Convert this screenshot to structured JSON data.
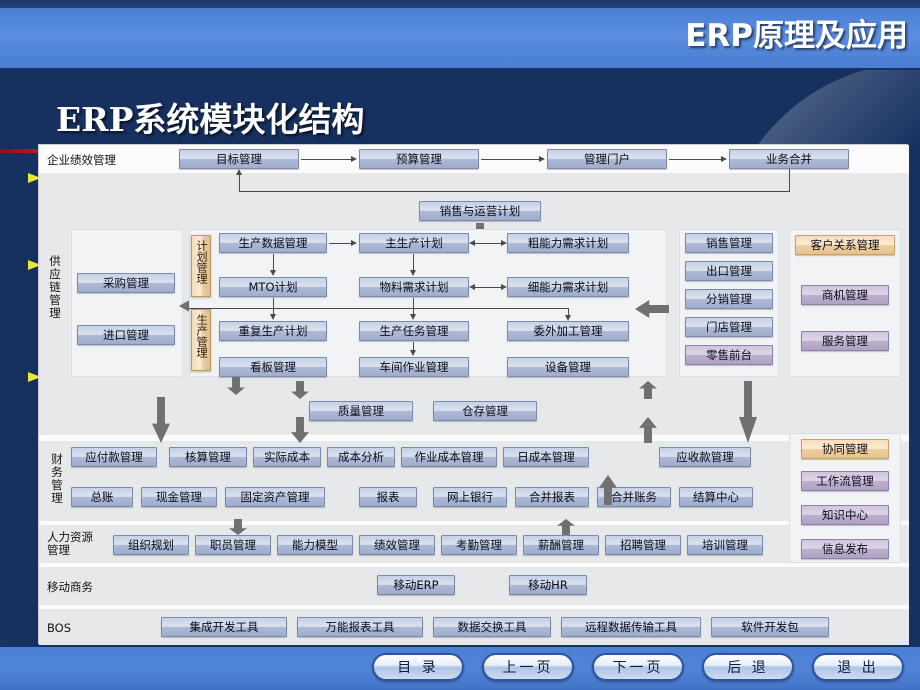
{
  "header": {
    "course_title": "ERP原理及应用",
    "slide_title": "ERP系统模块化结构"
  },
  "diagram": {
    "row_labels": {
      "epm": "企业绩效管理",
      "scm": "供应链管理",
      "fin": "财务管理",
      "hr": "人力资源管理",
      "mobile": "移动商务",
      "bos": "BOS"
    },
    "vertical_strips": [
      {
        "label": "计划管理"
      },
      {
        "label": "生产管理"
      }
    ],
    "epm_row": [
      "目标管理",
      "预算管理",
      "管理门户",
      "业务合并"
    ],
    "sop": "销售与运营计划",
    "supply": [
      "采购管理",
      "进口管理"
    ],
    "production_col1": [
      "生产数据管理",
      "MTO计划",
      "重复生产计划",
      "看板管理"
    ],
    "production_col2": [
      "主生产计划",
      "物料需求计划",
      "生产任务管理",
      "车间作业管理"
    ],
    "production_col3": [
      "粗能力需求计划",
      "细能力需求计划",
      "委外加工管理",
      "设备管理"
    ],
    "sales": [
      "销售管理",
      "出口管理",
      "分销管理",
      "门店管理",
      "零售前台"
    ],
    "crm_header": "客户关系管理",
    "crm": [
      "商机管理",
      "服务管理"
    ],
    "quality_row": [
      "质量管理",
      "仓存管理"
    ],
    "finance_row1": [
      "应付款管理",
      "核算管理",
      "实际成本",
      "成本分析",
      "作业成本管理",
      "日成本管理",
      "应收款管理"
    ],
    "finance_row2": [
      "总账",
      "现金管理",
      "固定资产管理",
      "报表",
      "网上银行",
      "合并报表",
      "合并账务",
      "结算中心"
    ],
    "hr_row": [
      "组织规划",
      "职员管理",
      "能力模型",
      "绩效管理",
      "考勤管理",
      "薪酬管理",
      "招聘管理",
      "培训管理"
    ],
    "mobile_row": [
      "移动ERP",
      "移动HR"
    ],
    "bos_row": [
      "集成开发工具",
      "万能报表工具",
      "数据交换工具",
      "远程数据传输工具",
      "软件开发包"
    ],
    "collab_header": "协同管理",
    "collab": [
      "工作流管理",
      "知识中心",
      "信息发布"
    ]
  },
  "nav": {
    "buttons": [
      "目 录",
      "上一页",
      "下一页",
      "后 退",
      "退 出"
    ]
  },
  "colors": {
    "banner_blue": "#4a7fd4",
    "dark_navy": "#16305f",
    "accent_red": "#d01818",
    "accent_yellow": "#e8e830",
    "module_blue": "#aebad6",
    "module_tan": "#efd0a2",
    "module_purple": "#bdb0cf"
  }
}
